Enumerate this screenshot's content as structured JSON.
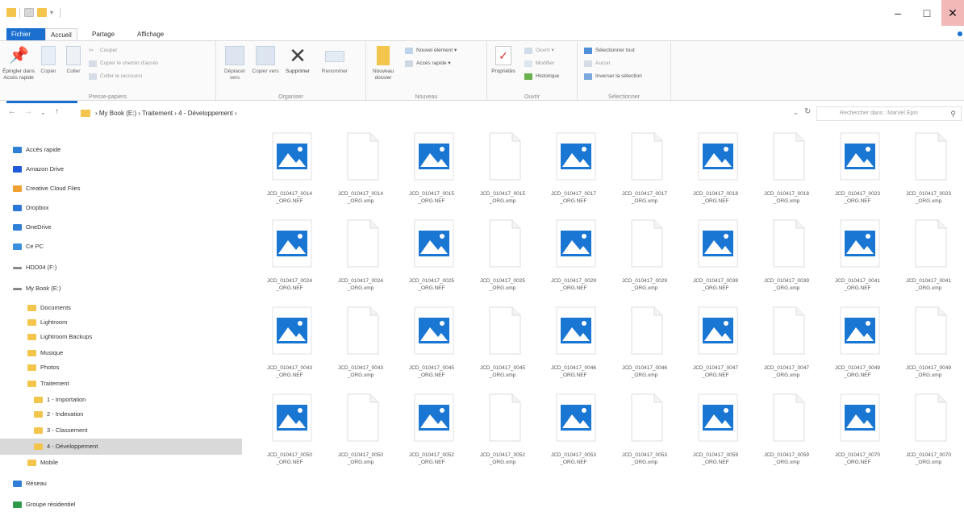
{
  "title_bar": {
    "minimize": "–",
    "maximize": "□",
    "close": "✕"
  },
  "ribbon_tabs": {
    "file": "Fichier",
    "home": "Accueil",
    "share": "Partage",
    "view": "Affichage"
  },
  "ribbon": {
    "clipboard": {
      "group_label": "Presse-papiers",
      "pin": "Épingler dans Accès rapide",
      "copy": "Copier",
      "paste": "Coller",
      "cut": "Couper",
      "copy_path": "Copier le chemin d'accès",
      "paste_shortcut": "Coller le raccourci"
    },
    "organize": {
      "group_label": "Organiser",
      "move_to": "Déplacer vers",
      "copy_to": "Copier vers",
      "delete": "Supprimer",
      "rename": "Renommer"
    },
    "new": {
      "group_label": "Nouveau",
      "new_folder": "Nouveau dossier",
      "new_item": "Nouvel élément ▾",
      "easy_access": "Accès rapide ▾"
    },
    "open": {
      "group_label": "Ouvrir",
      "properties": "Propriétés",
      "open": "Ouvrir ▾",
      "edit": "Modifier",
      "history": "Historique"
    },
    "select": {
      "group_label": "Sélectionner",
      "select_all": "Sélectionner tout",
      "select_none": "Aucun",
      "invert": "Inverser la sélection"
    }
  },
  "address_bar": {
    "path": "› My Book (E:)  ›  Traitement  ›  4 - Développement  ›",
    "search_placeholder": "Rechercher dans : MarVel Epin"
  },
  "sidebar": {
    "items": [
      {
        "label": "Accès rapide",
        "icon": "star-icon",
        "color": "#2f7fd6"
      },
      {
        "label": "Amazon Drive",
        "icon": "amazon-drive-icon",
        "color": "#1f5bd8"
      },
      {
        "label": "Creative Cloud Files",
        "icon": "creative-cloud-icon",
        "color": "#f0a030"
      },
      {
        "label": "Dropbox",
        "icon": "dropbox-icon",
        "color": "#2d77d8"
      },
      {
        "label": "OneDrive",
        "icon": "onedrive-icon",
        "color": "#2f7fd6"
      },
      {
        "label": "Ce PC",
        "icon": "pc-icon",
        "color": "#3a8ee0"
      },
      {
        "label": "HDD04 (F:)",
        "icon": "drive-icon",
        "color": "#888888"
      },
      {
        "label": "My Book (E:)",
        "icon": "drive-icon",
        "color": "#888888"
      },
      {
        "label": "Documents",
        "icon": "folder-icon",
        "color": "#f3c54c"
      },
      {
        "label": "Lightroom",
        "icon": "folder-icon",
        "color": "#f3c54c"
      },
      {
        "label": "Lightroom Backups",
        "icon": "folder-icon",
        "color": "#f3c54c"
      },
      {
        "label": "Musique",
        "icon": "folder-icon",
        "color": "#f3c54c"
      },
      {
        "label": "Photos",
        "icon": "folder-icon",
        "color": "#f3c54c"
      },
      {
        "label": "Traitement",
        "icon": "folder-icon",
        "color": "#f3c54c"
      },
      {
        "label": "1 - Importation",
        "icon": "folder-icon",
        "color": "#f3c54c"
      },
      {
        "label": "2 - Indexation",
        "icon": "folder-icon",
        "color": "#f3c54c"
      },
      {
        "label": "3 - Classement",
        "icon": "folder-icon",
        "color": "#f3c54c"
      },
      {
        "label": "4 - Développement",
        "icon": "folder-icon",
        "color": "#f3c54c"
      },
      {
        "label": "Mobile",
        "icon": "folder-icon",
        "color": "#f3c54c"
      },
      {
        "label": "Réseau",
        "icon": "network-icon",
        "color": "#2f7fd6"
      },
      {
        "label": "Groupe résidentiel",
        "icon": "homegroup-icon",
        "color": "#2e9a4a"
      }
    ]
  },
  "files": [
    {
      "name": "JCD_010417_0014_ORG.NEF",
      "type": "image"
    },
    {
      "name": "JCD_010417_0014_ORG.xmp",
      "type": "doc"
    },
    {
      "name": "JCD_010417_0015_ORG.NEF",
      "type": "image"
    },
    {
      "name": "JCD_010417_0015_ORG.xmp",
      "type": "doc"
    },
    {
      "name": "JCD_010417_0017_ORG.NEF",
      "type": "image"
    },
    {
      "name": "JCD_010417_0017_ORG.xmp",
      "type": "doc"
    },
    {
      "name": "JCD_010417_0018_ORG.NEF",
      "type": "image"
    },
    {
      "name": "JCD_010417_0018_ORG.xmp",
      "type": "doc"
    },
    {
      "name": "JCD_010417_0023_ORG.NEF",
      "type": "image"
    },
    {
      "name": "JCD_010417_0023_ORG.xmp",
      "type": "doc"
    },
    {
      "name": "JCD_010417_0024_ORG.NEF",
      "type": "image"
    },
    {
      "name": "JCD_010417_0024_ORG.xmp",
      "type": "doc"
    },
    {
      "name": "JCD_010417_0025_ORG.NEF",
      "type": "image"
    },
    {
      "name": "JCD_010417_0025_ORG.xmp",
      "type": "doc"
    },
    {
      "name": "JCD_010417_0029_ORG.NEF",
      "type": "image"
    },
    {
      "name": "JCD_010417_0029_ORG.xmp",
      "type": "doc"
    },
    {
      "name": "JCD_010417_0039_ORG.NEF",
      "type": "image"
    },
    {
      "name": "JCD_010417_0039_ORG.xmp",
      "type": "doc"
    },
    {
      "name": "JCD_010417_0041_ORG.NEF",
      "type": "image"
    },
    {
      "name": "JCD_010417_0041_ORG.xmp",
      "type": "doc"
    },
    {
      "name": "JCD_010417_0043_ORG.NEF",
      "type": "image"
    },
    {
      "name": "JCD_010417_0043_ORG.xmp",
      "type": "doc"
    },
    {
      "name": "JCD_010417_0045_ORG.NEF",
      "type": "image"
    },
    {
      "name": "JCD_010417_0045_ORG.xmp",
      "type": "doc"
    },
    {
      "name": "JCD_010417_0046_ORG.NEF",
      "type": "image"
    },
    {
      "name": "JCD_010417_0046_ORG.xmp",
      "type": "doc"
    },
    {
      "name": "JCD_010417_0047_ORG.NEF",
      "type": "image"
    },
    {
      "name": "JCD_010417_0047_ORG.xmp",
      "type": "doc"
    },
    {
      "name": "JCD_010417_0049_ORG.NEF",
      "type": "image"
    },
    {
      "name": "JCD_010417_0049_ORG.xmp",
      "type": "doc"
    },
    {
      "name": "JCD_010417_0050_ORG.NEF",
      "type": "image"
    },
    {
      "name": "JCD_010417_0050_ORG.xmp",
      "type": "doc"
    },
    {
      "name": "JCD_010417_0052_ORG.NEF",
      "type": "image"
    },
    {
      "name": "JCD_010417_0052_ORG.xmp",
      "type": "doc"
    },
    {
      "name": "JCD_010417_0053_ORG.NEF",
      "type": "image"
    },
    {
      "name": "JCD_010417_0053_ORG.xmp",
      "type": "doc"
    },
    {
      "name": "JCD_010417_0059_ORG.NEF",
      "type": "image"
    },
    {
      "name": "JCD_010417_0059_ORG.xmp",
      "type": "doc"
    },
    {
      "name": "JCD_010417_0070_ORG.NEF",
      "type": "image"
    },
    {
      "name": "JCD_010417_0070_ORG.xmp",
      "type": "doc"
    }
  ],
  "colors": {
    "accent": "#1a6fcf",
    "image_icon": "#1976d2",
    "selected_row": "#d9d9d9",
    "folder": "#f3c54c"
  }
}
